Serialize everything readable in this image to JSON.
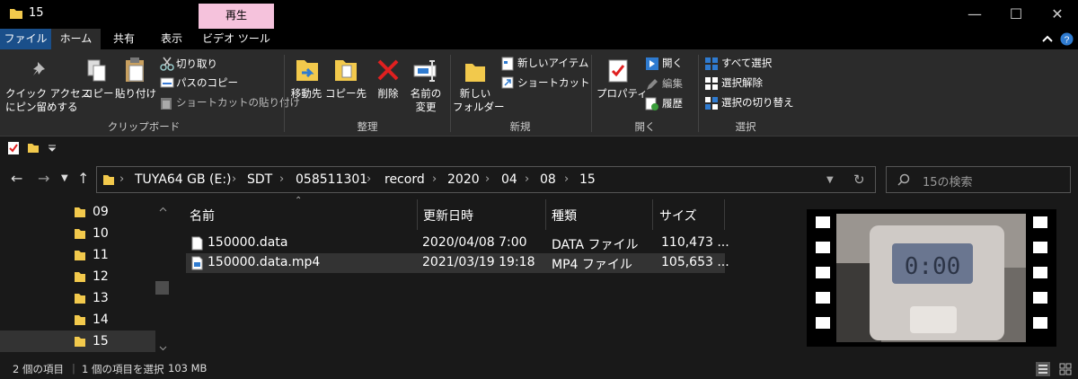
{
  "window": {
    "title": "15",
    "context_tab": "再生",
    "minimize": "—",
    "maximize": "☐",
    "close": "✕"
  },
  "tabs": [
    {
      "label": "ファイル"
    },
    {
      "label": "ホーム"
    },
    {
      "label": "共有"
    },
    {
      "label": "表示"
    },
    {
      "label": "ビデオ ツール"
    }
  ],
  "ribbon": {
    "clipboard": {
      "pin_line1": "クイック アクセス",
      "pin_line2": "にピン留めする",
      "copy": "コピー",
      "paste": "貼り付け",
      "cut": "切り取り",
      "copy_path": "パスのコピー",
      "paste_shortcut": "ショートカットの貼り付け",
      "label": "クリップボード"
    },
    "organize": {
      "move_to": "移動先",
      "copy_to": "コピー先",
      "delete": "削除",
      "rename_line1": "名前の",
      "rename_line2": "変更",
      "label": "整理"
    },
    "new": {
      "new_folder_line1": "新しい",
      "new_folder_line2": "フォルダー",
      "new_item": "新しいアイテム",
      "shortcut": "ショートカット",
      "label": "新規"
    },
    "open": {
      "properties": "プロパティ",
      "open": "開く",
      "edit": "編集",
      "history": "履歴",
      "label": "開く"
    },
    "select": {
      "select_all": "すべて選択",
      "select_none": "選択解除",
      "invert": "選択の切り替え",
      "label": "選択"
    }
  },
  "address": {
    "crumbs": [
      "TUYA64 GB (E:)",
      "SDT",
      "058511301",
      "record",
      "2020",
      "04",
      "08",
      "15"
    ],
    "search_placeholder": "15の検索"
  },
  "nav_tree": [
    {
      "label": "09",
      "selected": false
    },
    {
      "label": "10",
      "selected": false
    },
    {
      "label": "11",
      "selected": false
    },
    {
      "label": "12",
      "selected": false
    },
    {
      "label": "13",
      "selected": false
    },
    {
      "label": "14",
      "selected": false
    },
    {
      "label": "15",
      "selected": true
    }
  ],
  "columns": {
    "name": "名前",
    "date": "更新日時",
    "type": "種類",
    "size": "サイズ"
  },
  "files": [
    {
      "name": "150000.data",
      "date": "2020/04/08 7:00",
      "type": "DATA ファイル",
      "size": "110,473 ...",
      "selected": false
    },
    {
      "name": "150000.data.mp4",
      "date": "2021/03/19 19:18",
      "type": "MP4 ファイル",
      "size": "105,653 ...",
      "selected": true
    }
  ],
  "preview": {
    "display_text": "0:00"
  },
  "status": {
    "item_count": "2 個の項目",
    "selected": "1 個の項目を選択",
    "size": "103 MB"
  },
  "colors": {
    "accent": "#1a4f8a",
    "context_tab": "#f5c2dc",
    "folder": "#f2c94c"
  }
}
